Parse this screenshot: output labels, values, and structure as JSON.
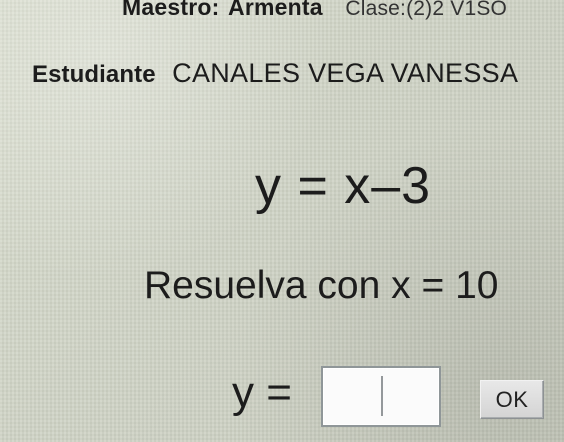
{
  "header": {
    "teacher_label": "Maestro:",
    "teacher_name": "Armenta",
    "class_label": "Clase:(2)2 V1SO"
  },
  "student": {
    "label": "Estudiante",
    "name": "CANALES VEGA VANESSA"
  },
  "problem": {
    "equation": "y = x–3",
    "instruction": "Resuelva con x = 10",
    "answer_label": "y =",
    "answer_value": ""
  },
  "actions": {
    "ok_label": "OK"
  }
}
